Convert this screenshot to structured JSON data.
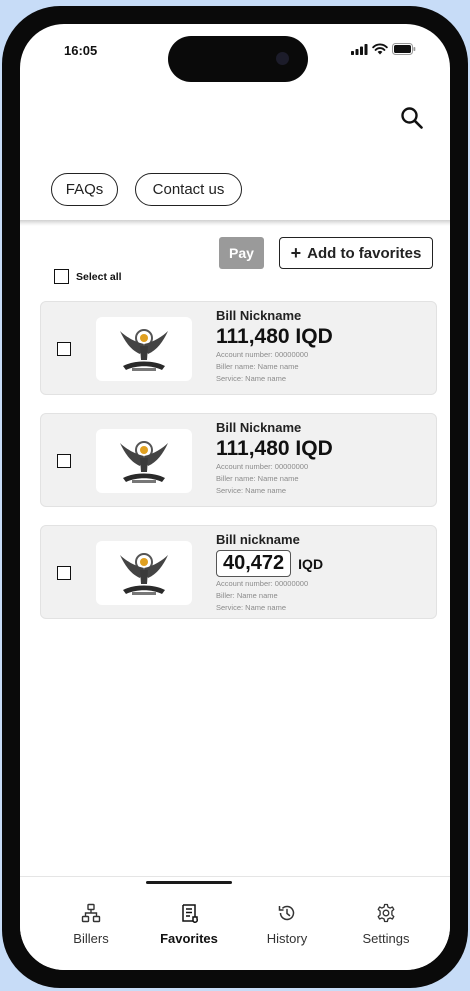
{
  "status_bar": {
    "time": "16:05"
  },
  "top_links": {
    "faqs": "FAQs",
    "contact": "Contact us"
  },
  "actions": {
    "pay_label": "Pay",
    "add_favorites_label": "Add to favorites",
    "select_all_label": "Select all"
  },
  "bills": [
    {
      "nickname": "Bill Nickname",
      "amount": "111,480 IQD",
      "account": "Account number: 00000000",
      "biller": "Biller name: Name name",
      "service": "Service: Name name",
      "checked": false
    },
    {
      "nickname": "Bill Nickname",
      "amount": "111,480 IQD",
      "account": "Account number: 00000000",
      "biller": "Biller name: Name name",
      "service": "Service: Name name",
      "checked": false
    },
    {
      "nickname": "Bill nickname",
      "amount_value": "40,472",
      "currency": "IQD",
      "account": "Account number: 00000000",
      "biller": "Biller: Name name",
      "service": "Service: Name name",
      "checked": false
    }
  ],
  "nav": [
    {
      "label": "Billers",
      "icon": "sitemap-icon",
      "active": false
    },
    {
      "label": "Favorites",
      "icon": "receipt-icon",
      "active": true
    },
    {
      "label": "History",
      "icon": "history-icon",
      "active": false
    },
    {
      "label": "Settings",
      "icon": "gear-icon",
      "active": false
    }
  ],
  "colors": {
    "background": "#c7dcf7",
    "card": "#f1f1f1",
    "pay_disabled": "#9a9a9a"
  }
}
